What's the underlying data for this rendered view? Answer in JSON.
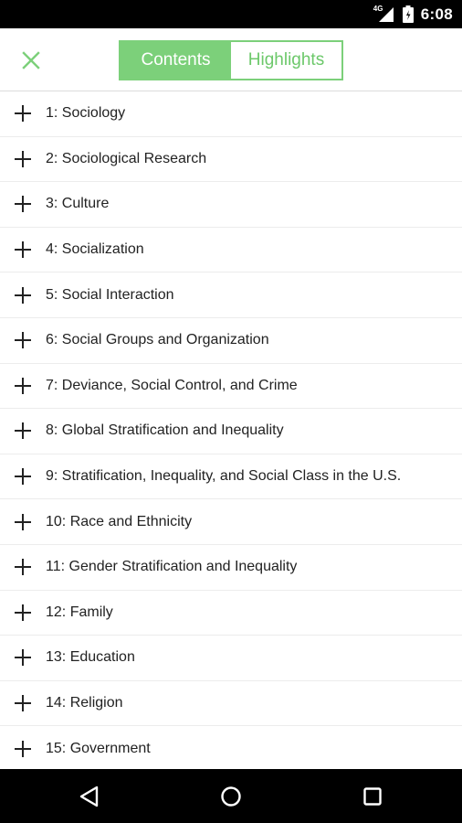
{
  "status_bar": {
    "network": "4G",
    "signal_icon": "signal-icon",
    "battery_icon": "battery-icon",
    "time": "6:08"
  },
  "toolbar": {
    "close_icon": "close-icon",
    "tabs": [
      {
        "label": "Contents",
        "active": true
      },
      {
        "label": "Highlights",
        "active": false
      }
    ]
  },
  "contents": {
    "items": [
      {
        "label": "1: Sociology"
      },
      {
        "label": "2: Sociological Research"
      },
      {
        "label": "3: Culture"
      },
      {
        "label": "4: Socialization"
      },
      {
        "label": "5: Social Interaction"
      },
      {
        "label": "6: Social Groups and Organization"
      },
      {
        "label": "7: Deviance, Social Control, and Crime"
      },
      {
        "label": "8: Global Stratification and Inequality"
      },
      {
        "label": "9: Stratification, Inequality, and Social Class in the U.S."
      },
      {
        "label": "10: Race and Ethnicity"
      },
      {
        "label": "11: Gender Stratification and Inequality"
      },
      {
        "label": "12: Family"
      },
      {
        "label": "13: Education"
      },
      {
        "label": "14: Religion"
      },
      {
        "label": "15: Government"
      }
    ],
    "expand_icon": "plus-icon"
  },
  "nav_bar": {
    "back_icon": "back-icon",
    "home_icon": "home-icon",
    "recents_icon": "recents-icon"
  },
  "colors": {
    "accent": "#7cd07a",
    "status_bar": "#000000",
    "nav_bar": "#000000"
  }
}
